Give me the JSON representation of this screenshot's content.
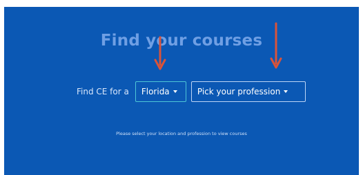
{
  "hero": {
    "title": "Find your courses",
    "finder": {
      "prefix": "Find CE for a",
      "location_select": {
        "selected": "Florida"
      },
      "profession_select": {
        "selected": "Pick your profession"
      }
    },
    "hint": "Please select your location and profession to view courses"
  },
  "annotations": {
    "arrow_color": "#d9533a"
  },
  "colors": {
    "hero_background": "#0b58b4",
    "title": "#6f9fe4",
    "location_select_border": "#4ec6d6"
  }
}
